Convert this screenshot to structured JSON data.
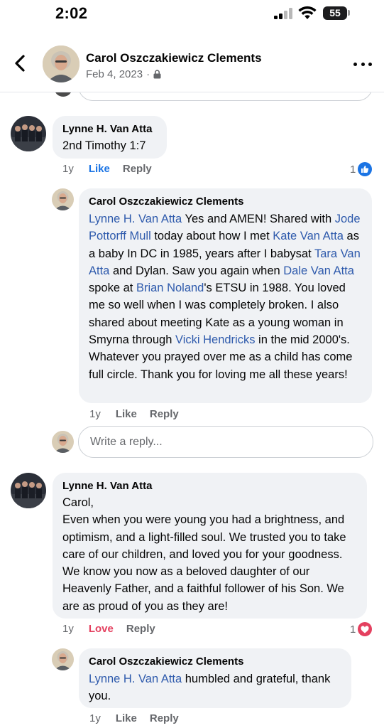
{
  "status_bar": {
    "time": "2:02",
    "battery": "55"
  },
  "header": {
    "name": "Carol Oszczakiewicz Clements",
    "date": "Feb 4, 2023",
    "separator": "·"
  },
  "comments": [
    {
      "author": "Lynne H. Van Atta",
      "text": "2nd Timothy 1:7",
      "time": "1y",
      "like_label": "Like",
      "reply_label": "Reply",
      "reaction_count": "1",
      "reaction": "like"
    },
    {
      "author": "Carol Oszczakiewicz Clements",
      "segments": [
        {
          "t": "Lynne H. Van Atta",
          "m": true
        },
        {
          "t": "  Yes and AMEN!   Shared with ",
          "m": false
        },
        {
          "t": "Jode Pottorff Mull",
          "m": true
        },
        {
          "t": " today about how I met ",
          "m": false
        },
        {
          "t": "Kate Van Atta",
          "m": true
        },
        {
          "t": " as a baby In DC in 1985,  years after I babysat ",
          "m": false
        },
        {
          "t": "Tara Van Atta",
          "m": true
        },
        {
          "t": " and Dylan.  Saw you again when ",
          "m": false
        },
        {
          "t": "Dale Van Atta",
          "m": true
        },
        {
          "t": " spoke at ",
          "m": false
        },
        {
          "t": "Brian Noland",
          "m": true
        },
        {
          "t": "'s ETSU in 1988.  You loved me so well when I was completely broken.   I also shared about meeting Kate as a young woman in Smyrna through ",
          "m": false
        },
        {
          "t": "Vicki Hendricks",
          "m": true
        },
        {
          "t": " in the mid 2000's.  Whatever you prayed over me as a child has come full circle.  Thank you for loving me all these years!",
          "m": false
        }
      ],
      "time": "1y",
      "like_label": "Like",
      "reply_label": "Reply"
    },
    {
      "author": "Lynne H. Van Atta",
      "paragraphs": [
        "Carol,",
        "Even when you were young you had a brightness, and optimism, and a light-filled soul.  We trusted you to take care of our children, and loved you for your goodness. We know you now as a beloved daughter of our Heavenly Father, and a faithful follower of his Son. We are as proud of you as they are!"
      ],
      "time": "1y",
      "like_label": "Love",
      "reply_label": "Reply",
      "reaction_count": "1",
      "reaction": "love"
    },
    {
      "author": "Carol Oszczakiewicz Clements",
      "segments": [
        {
          "t": "Lynne H. Van Atta",
          "m": true
        },
        {
          "t": " humbled and grateful, thank you.",
          "m": false
        }
      ],
      "time": "1y",
      "like_label": "Like",
      "reply_label": "Reply"
    }
  ],
  "reply_box": {
    "placeholder": "Write a reply..."
  },
  "colors": {
    "mention": "#2e5aac",
    "like_blue": "#1b74e4",
    "love_red": "#e4405f",
    "bubble": "#f0f2f5",
    "meta": "#65676b"
  }
}
